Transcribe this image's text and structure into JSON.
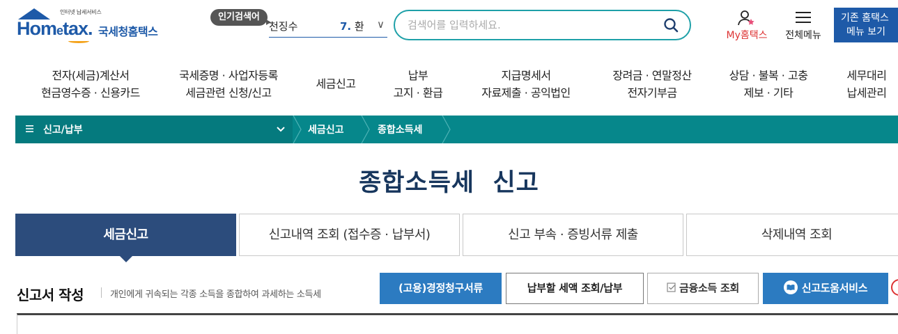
{
  "header": {
    "logo_tagline": "인터넷 납세서비스",
    "logo_word_a": "Hom",
    "logo_word_e": "e",
    "logo_word_b": "tax.",
    "logo_kr": "국세청홈택스",
    "popular_badge": "인기검색어",
    "popular_left": "천징수",
    "popular_rank": "7.",
    "popular_right": "환",
    "search_placeholder": "검색어를 입력하세요.",
    "my_hometax": "My홈택스",
    "all_menu": "전체메뉴",
    "old_hometax_line1": "기존 홈택스",
    "old_hometax_line2": "메뉴 보기"
  },
  "gnb": [
    {
      "line1": "전자(세금)계산서",
      "line2": "현금영수증 · 신용카드"
    },
    {
      "line1": "국세증명 · 사업자등록",
      "line2": "세금관련 신청/신고"
    },
    {
      "line1": "세금신고",
      "line2": ""
    },
    {
      "line1": "납부",
      "line2": "고지 · 환급"
    },
    {
      "line1": "지급명세서",
      "line2": "자료제출 · 공익법인"
    },
    {
      "line1": "장려금 · 연말정산",
      "line2": "전자기부금"
    },
    {
      "line1": "상담 · 불복 · 고충",
      "line2": "제보 · 기타"
    },
    {
      "line1": "세무대리",
      "line2": "납세관리"
    }
  ],
  "breadcrumb": {
    "menu": "신고/납부",
    "items": [
      "세금신고",
      "종합소득세"
    ]
  },
  "page_title": "종합소득세  신고",
  "tabs": [
    "세금신고",
    "신고내역 조회 (접수증 · 납부서)",
    "신고 부속 · 증빙서류 제출",
    "삭제내역 조회"
  ],
  "section": {
    "title": "신고서 작성",
    "desc": "개인에게 귀속되는 각종 소득을 종합하여 과세하는 소득세"
  },
  "buttons": {
    "b1": "(고용)경정청구서류",
    "b2": "납부할 세액 조회/납부",
    "b3": "금융소득 조회",
    "b4": "신고도움서비스"
  },
  "colors": {
    "brand": "#1e5aa8",
    "teal": "#06878b",
    "navy": "#2c4c7c",
    "button_blue": "#2c7bc1"
  }
}
